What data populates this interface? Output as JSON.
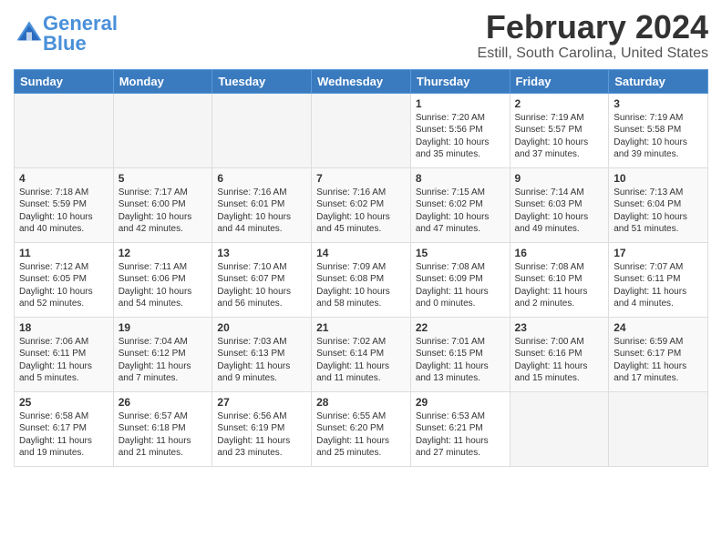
{
  "header": {
    "logo_line1": "General",
    "logo_line2": "Blue",
    "month": "February 2024",
    "location": "Estill, South Carolina, United States"
  },
  "weekdays": [
    "Sunday",
    "Monday",
    "Tuesday",
    "Wednesday",
    "Thursday",
    "Friday",
    "Saturday"
  ],
  "weeks": [
    [
      {
        "day": "",
        "info": ""
      },
      {
        "day": "",
        "info": ""
      },
      {
        "day": "",
        "info": ""
      },
      {
        "day": "",
        "info": ""
      },
      {
        "day": "1",
        "info": "Sunrise: 7:20 AM\nSunset: 5:56 PM\nDaylight: 10 hours\nand 35 minutes."
      },
      {
        "day": "2",
        "info": "Sunrise: 7:19 AM\nSunset: 5:57 PM\nDaylight: 10 hours\nand 37 minutes."
      },
      {
        "day": "3",
        "info": "Sunrise: 7:19 AM\nSunset: 5:58 PM\nDaylight: 10 hours\nand 39 minutes."
      }
    ],
    [
      {
        "day": "4",
        "info": "Sunrise: 7:18 AM\nSunset: 5:59 PM\nDaylight: 10 hours\nand 40 minutes."
      },
      {
        "day": "5",
        "info": "Sunrise: 7:17 AM\nSunset: 6:00 PM\nDaylight: 10 hours\nand 42 minutes."
      },
      {
        "day": "6",
        "info": "Sunrise: 7:16 AM\nSunset: 6:01 PM\nDaylight: 10 hours\nand 44 minutes."
      },
      {
        "day": "7",
        "info": "Sunrise: 7:16 AM\nSunset: 6:02 PM\nDaylight: 10 hours\nand 45 minutes."
      },
      {
        "day": "8",
        "info": "Sunrise: 7:15 AM\nSunset: 6:02 PM\nDaylight: 10 hours\nand 47 minutes."
      },
      {
        "day": "9",
        "info": "Sunrise: 7:14 AM\nSunset: 6:03 PM\nDaylight: 10 hours\nand 49 minutes."
      },
      {
        "day": "10",
        "info": "Sunrise: 7:13 AM\nSunset: 6:04 PM\nDaylight: 10 hours\nand 51 minutes."
      }
    ],
    [
      {
        "day": "11",
        "info": "Sunrise: 7:12 AM\nSunset: 6:05 PM\nDaylight: 10 hours\nand 52 minutes."
      },
      {
        "day": "12",
        "info": "Sunrise: 7:11 AM\nSunset: 6:06 PM\nDaylight: 10 hours\nand 54 minutes."
      },
      {
        "day": "13",
        "info": "Sunrise: 7:10 AM\nSunset: 6:07 PM\nDaylight: 10 hours\nand 56 minutes."
      },
      {
        "day": "14",
        "info": "Sunrise: 7:09 AM\nSunset: 6:08 PM\nDaylight: 10 hours\nand 58 minutes."
      },
      {
        "day": "15",
        "info": "Sunrise: 7:08 AM\nSunset: 6:09 PM\nDaylight: 11 hours\nand 0 minutes."
      },
      {
        "day": "16",
        "info": "Sunrise: 7:08 AM\nSunset: 6:10 PM\nDaylight: 11 hours\nand 2 minutes."
      },
      {
        "day": "17",
        "info": "Sunrise: 7:07 AM\nSunset: 6:11 PM\nDaylight: 11 hours\nand 4 minutes."
      }
    ],
    [
      {
        "day": "18",
        "info": "Sunrise: 7:06 AM\nSunset: 6:11 PM\nDaylight: 11 hours\nand 5 minutes."
      },
      {
        "day": "19",
        "info": "Sunrise: 7:04 AM\nSunset: 6:12 PM\nDaylight: 11 hours\nand 7 minutes."
      },
      {
        "day": "20",
        "info": "Sunrise: 7:03 AM\nSunset: 6:13 PM\nDaylight: 11 hours\nand 9 minutes."
      },
      {
        "day": "21",
        "info": "Sunrise: 7:02 AM\nSunset: 6:14 PM\nDaylight: 11 hours\nand 11 minutes."
      },
      {
        "day": "22",
        "info": "Sunrise: 7:01 AM\nSunset: 6:15 PM\nDaylight: 11 hours\nand 13 minutes."
      },
      {
        "day": "23",
        "info": "Sunrise: 7:00 AM\nSunset: 6:16 PM\nDaylight: 11 hours\nand 15 minutes."
      },
      {
        "day": "24",
        "info": "Sunrise: 6:59 AM\nSunset: 6:17 PM\nDaylight: 11 hours\nand 17 minutes."
      }
    ],
    [
      {
        "day": "25",
        "info": "Sunrise: 6:58 AM\nSunset: 6:17 PM\nDaylight: 11 hours\nand 19 minutes."
      },
      {
        "day": "26",
        "info": "Sunrise: 6:57 AM\nSunset: 6:18 PM\nDaylight: 11 hours\nand 21 minutes."
      },
      {
        "day": "27",
        "info": "Sunrise: 6:56 AM\nSunset: 6:19 PM\nDaylight: 11 hours\nand 23 minutes."
      },
      {
        "day": "28",
        "info": "Sunrise: 6:55 AM\nSunset: 6:20 PM\nDaylight: 11 hours\nand 25 minutes."
      },
      {
        "day": "29",
        "info": "Sunrise: 6:53 AM\nSunset: 6:21 PM\nDaylight: 11 hours\nand 27 minutes."
      },
      {
        "day": "",
        "info": ""
      },
      {
        "day": "",
        "info": ""
      }
    ]
  ]
}
